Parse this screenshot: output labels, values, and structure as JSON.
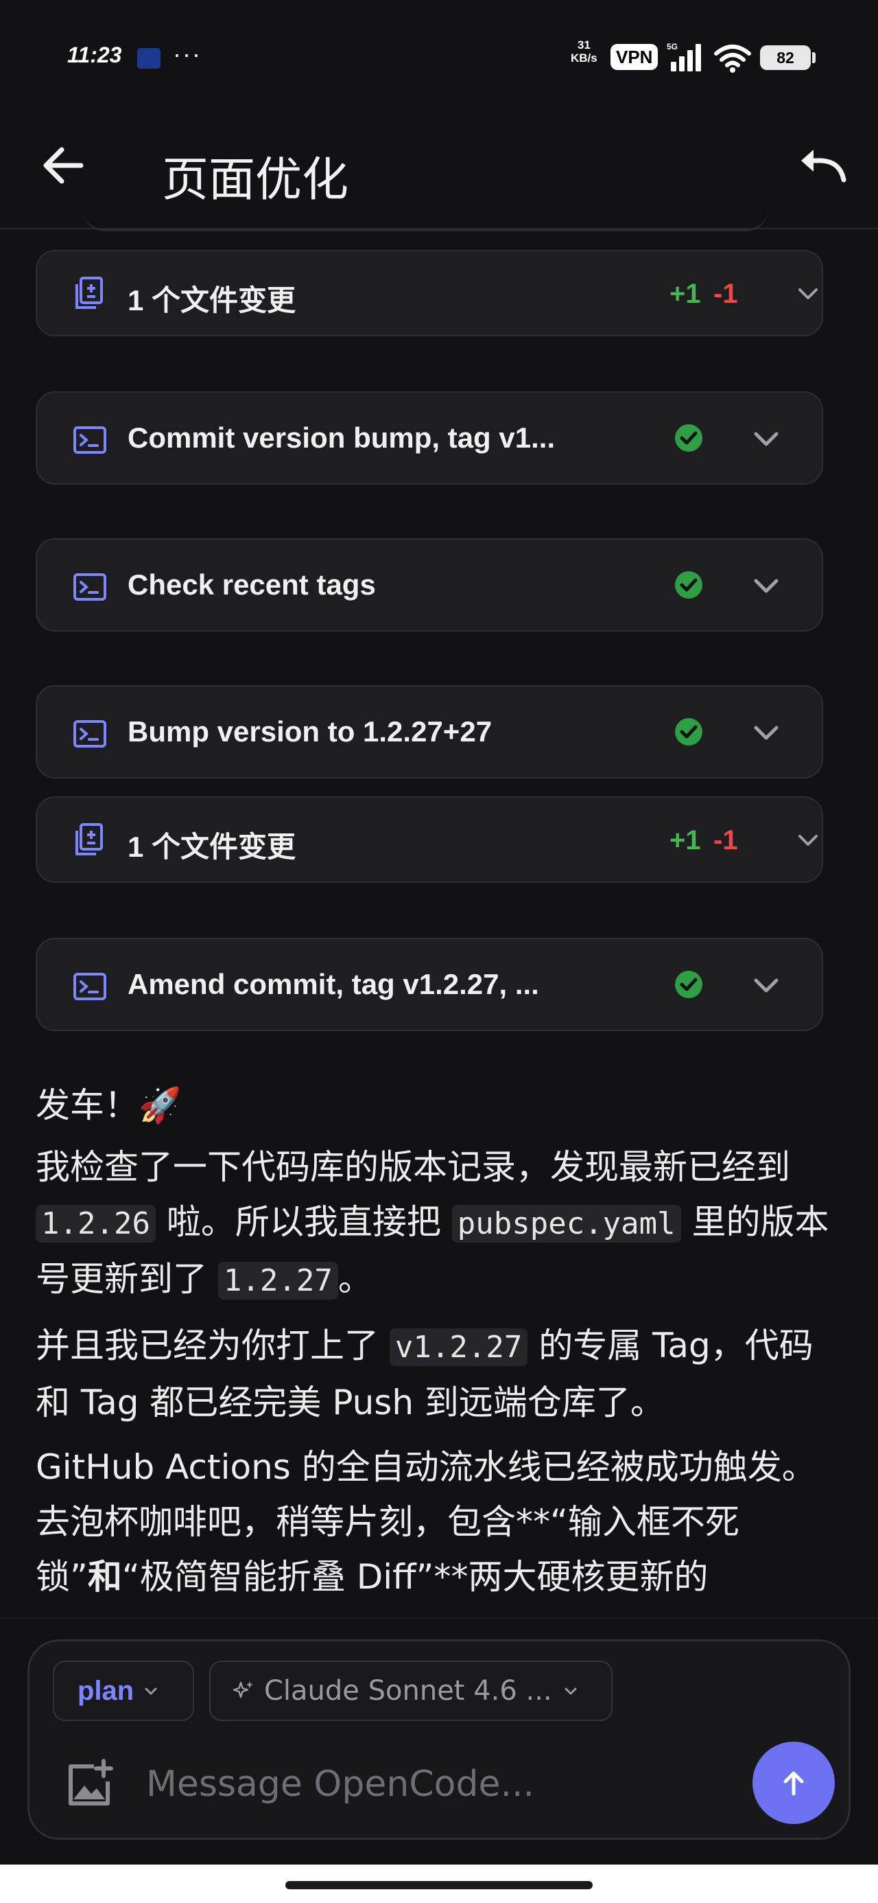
{
  "status_bar": {
    "time": "11:23",
    "more": "···",
    "net_speed_value": "31",
    "net_speed_unit": "KB/s",
    "vpn": "VPN",
    "battery": "82",
    "icons": [
      "app-notification-icon",
      "signal-icon",
      "wifi-icon",
      "battery-icon"
    ]
  },
  "header": {
    "title": "页面优化",
    "back_icon": "arrow-left-icon",
    "undo_icon": "undo-icon"
  },
  "cards": [
    {
      "kind": "diff",
      "icon": "file-diff-icon",
      "label": "1 个文件变更",
      "added": "+1",
      "removed": "-1"
    },
    {
      "kind": "terminal",
      "icon": "terminal-icon",
      "label": "Commit version bump, tag v1...",
      "status": "success"
    },
    {
      "kind": "terminal",
      "icon": "terminal-icon",
      "label": "Check recent tags",
      "status": "success"
    },
    {
      "kind": "terminal",
      "icon": "terminal-icon",
      "label": "Bump version to 1.2.27+27",
      "status": "success"
    },
    {
      "kind": "diff",
      "icon": "file-diff-icon",
      "label": "1 个文件变更",
      "added": "+1",
      "removed": "-1"
    },
    {
      "kind": "terminal",
      "icon": "terminal-icon",
      "label": "Amend commit, tag v1.2.27, ...",
      "status": "success"
    }
  ],
  "message": {
    "line1": "发车！🚀",
    "p2": {
      "a": "我检查了一下代码库的版本记录，发现最新已经到 ",
      "code1": "1.2.26",
      "b": " 啦。所以我直接把 ",
      "code2": "pubspec.yaml",
      "c": " 里的版本号更新到了 ",
      "code3": "1.2.27",
      "d": "。"
    },
    "p3": {
      "a": "并且我已经为你打上了 ",
      "code1": "v1.2.27",
      "b": " 的专属 Tag，代码和 Tag 都已经完美 Push 到远端仓库了。"
    },
    "p4": {
      "a": "GitHub Actions 的全自动流水线已经被成功触发。去泡杯咖啡吧，稍等片刻，包含**“输入框不死锁”",
      "bold": "和",
      "b": "“极简智能折叠 Diff”**两大硬核更新的"
    }
  },
  "composer": {
    "mode": "plan",
    "model": "Claude Sonnet 4.6 ...",
    "placeholder": "Message OpenCode...",
    "attach_icon": "add-image-icon",
    "send_icon": "arrow-up-icon"
  },
  "colors": {
    "background": "#121214",
    "card": "#1e1e21",
    "accent": "#6c72f2",
    "success": "#2ea043",
    "added": "#3fb950",
    "removed": "#f04848"
  }
}
